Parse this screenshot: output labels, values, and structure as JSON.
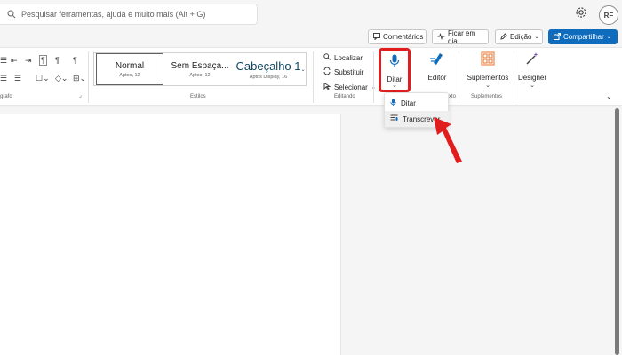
{
  "search": {
    "placeholder": "Pesquisar ferramentas, ajuda e muito mais (Alt + G)"
  },
  "user": {
    "initials": "RF"
  },
  "actions": {
    "comments": "Comentários",
    "catch_up": "Ficar em dia",
    "editing": "Edição",
    "share": "Compartilhar"
  },
  "ribbon": {
    "paragraph_label": "grafo",
    "styles_label": "Estilos",
    "editing_label": "Editando",
    "voice_label": "xto",
    "addins_label": "Suplementos",
    "styles": [
      {
        "name": "Normal",
        "sub": "Aptos, 12"
      },
      {
        "name": "Sem Espaça...",
        "sub": "Aptos, 12"
      },
      {
        "name": "Cabeçalho 1",
        "sub": "Aptos Display, 16"
      }
    ],
    "find": "Localizar",
    "replace": "Substituir",
    "select": "Selecionar",
    "dictate": "Ditar",
    "editor": "Editor",
    "addins": "Suplementos",
    "designer": "Designer"
  },
  "dictate_menu": {
    "items": [
      {
        "label": "Ditar",
        "icon": "mic-icon"
      },
      {
        "label": "Transcrever",
        "icon": "transcribe-icon"
      }
    ]
  },
  "colors": {
    "accent": "#0f6cbd",
    "highlight": "#e11d1d",
    "arrow": "#e11d1d"
  }
}
